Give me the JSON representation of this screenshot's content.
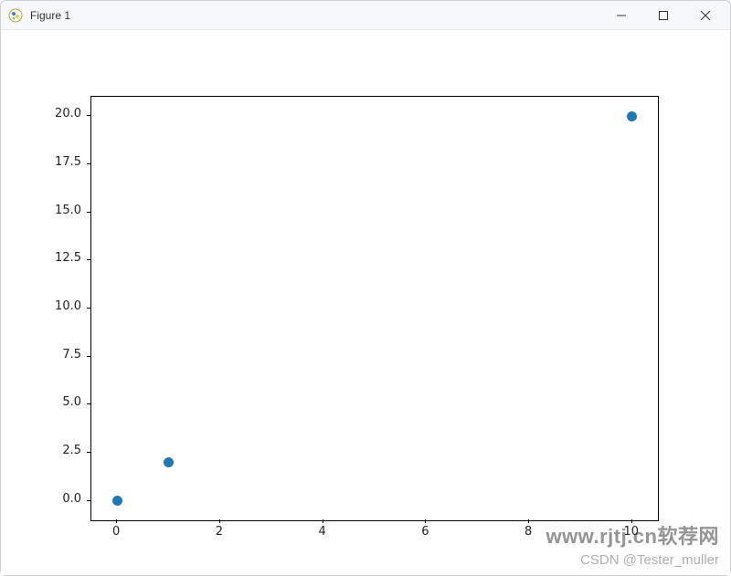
{
  "window": {
    "title": "Figure 1",
    "buttons": {
      "minimize": "minimize",
      "maximize": "maximize",
      "close": "close"
    }
  },
  "chart_data": {
    "type": "scatter",
    "x": [
      0,
      1,
      10
    ],
    "y": [
      0,
      2,
      20
    ],
    "xlim": [
      -0.5,
      10.5
    ],
    "ylim": [
      -1.0,
      21.0
    ],
    "xticks": [
      0,
      2,
      4,
      6,
      8,
      10
    ],
    "yticks": [
      0.0,
      2.5,
      5.0,
      7.5,
      10.0,
      12.5,
      15.0,
      17.5,
      20.0
    ],
    "ytick_labels": [
      "0.0",
      "2.5",
      "5.0",
      "7.5",
      "10.0",
      "12.5",
      "15.0",
      "17.5",
      "20.0"
    ],
    "xtick_labels": [
      "0",
      "2",
      "4",
      "6",
      "8",
      "10"
    ],
    "title": "",
    "xlabel": "",
    "ylabel": "",
    "marker_color": "#1f77b4"
  },
  "watermarks": {
    "line1": "www.rjtj.cn软荐网",
    "line2": "CSDN @Tester_muller"
  }
}
